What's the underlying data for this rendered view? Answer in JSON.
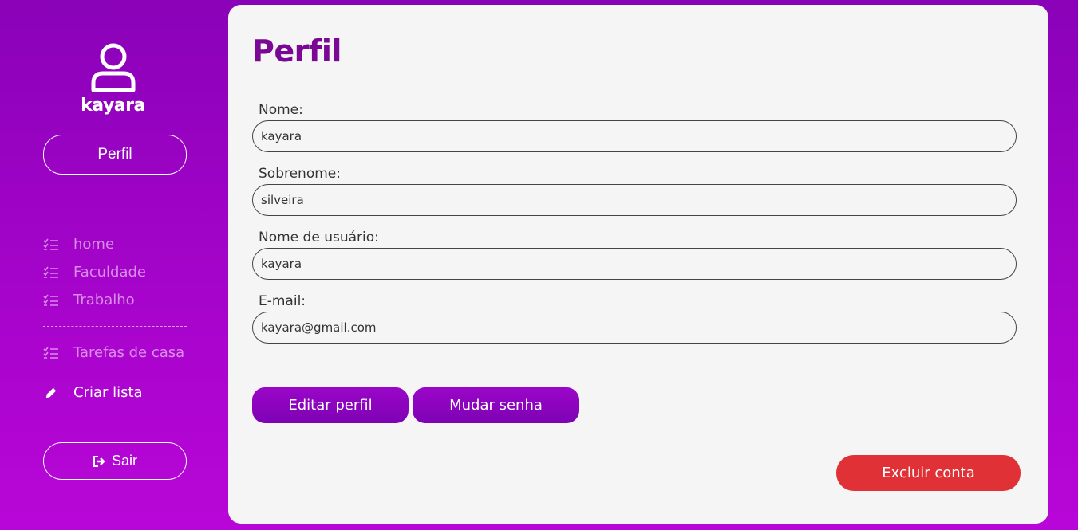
{
  "sidebar": {
    "username": "kayara",
    "profile_button": "Perfil",
    "nav": [
      {
        "label": "home",
        "icon": "checklist-icon"
      },
      {
        "label": "Faculdade",
        "icon": "checklist-icon"
      },
      {
        "label": "Trabalho",
        "icon": "checklist-icon"
      },
      {
        "label": "Tarefas de casa",
        "icon": "checklist-icon"
      },
      {
        "label": "Criar lista",
        "icon": "pencil-icon"
      }
    ],
    "logout_button": "Sair"
  },
  "main": {
    "title": "Perfil",
    "fields": [
      {
        "label": "Nome:",
        "value": "kayara"
      },
      {
        "label": "Sobrenome:",
        "value": "silveira"
      },
      {
        "label": "Nome de usuário:",
        "value": "kayara"
      },
      {
        "label": "E-mail:",
        "value": "kayara@gmail.com"
      }
    ],
    "edit_button": "Editar perfil",
    "password_button": "Mudar senha",
    "delete_button": "Excluir conta"
  },
  "colors": {
    "accent": "#8a02b8",
    "title": "#7a0894",
    "danger": "#e03236",
    "panel": "#f5f5f5"
  }
}
